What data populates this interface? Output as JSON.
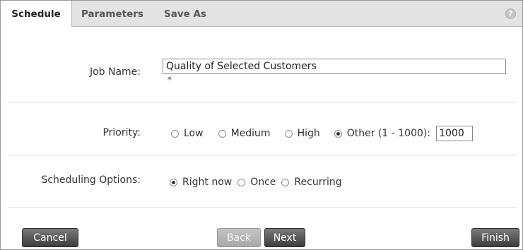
{
  "tabs": {
    "schedule": "Schedule",
    "parameters": "Parameters",
    "save_as": "Save As"
  },
  "help_icon": "?",
  "job_name": {
    "label": "Job Name:",
    "value": "Quality of Selected Customers",
    "required_marker": "*"
  },
  "priority": {
    "label": "Priority:",
    "options": [
      "Low",
      "Medium",
      "High",
      "Other (1 - 1000):"
    ],
    "selected": "Other (1 - 1000):",
    "other_value": "1000"
  },
  "scheduling": {
    "label": "Scheduling Options:",
    "options": [
      "Right now",
      "Once",
      "Recurring"
    ],
    "selected": "Right now"
  },
  "buttons": {
    "cancel": "Cancel",
    "back": "Back",
    "next": "Next",
    "finish": "Finish"
  }
}
